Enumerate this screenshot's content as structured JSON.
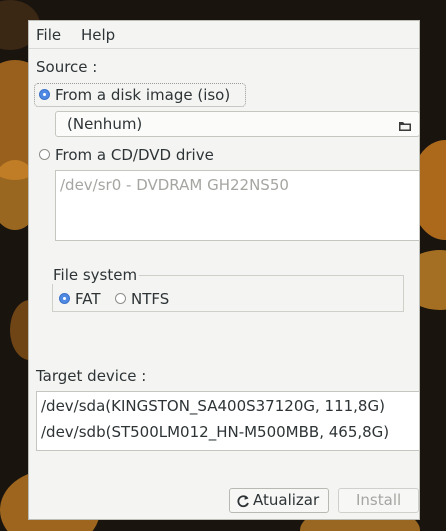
{
  "menu": {
    "file": "File",
    "help": "Help"
  },
  "source": {
    "label": "Source :",
    "disk_image_option": "From a disk image (iso)",
    "disk_image_selected": true,
    "file_combo_value": "(Nenhum)",
    "cd_option": "From a CD/DVD drive",
    "cd_selected": false,
    "cd_drives": [
      "/dev/sr0 - DVDRAM GH22NS50"
    ]
  },
  "filesystem": {
    "label": "File system",
    "options": [
      {
        "label": "FAT",
        "selected": true
      },
      {
        "label": "NTFS",
        "selected": false
      }
    ]
  },
  "target": {
    "label": "Target device :",
    "devices": [
      "/dev/sda(KINGSTON_SA400S37120G, 111,8G)",
      "/dev/sdb(ST500LM012_HN-M500MBB, 465,8G)"
    ]
  },
  "buttons": {
    "refresh": "Atualizar",
    "install": "Install"
  },
  "icons": {
    "folder": "folder-icon",
    "refresh": "refresh-icon"
  },
  "colors": {
    "accent": "#4f89e4",
    "window_bg": "#f4f4f3",
    "disabled_text": "#a5a5a1"
  }
}
